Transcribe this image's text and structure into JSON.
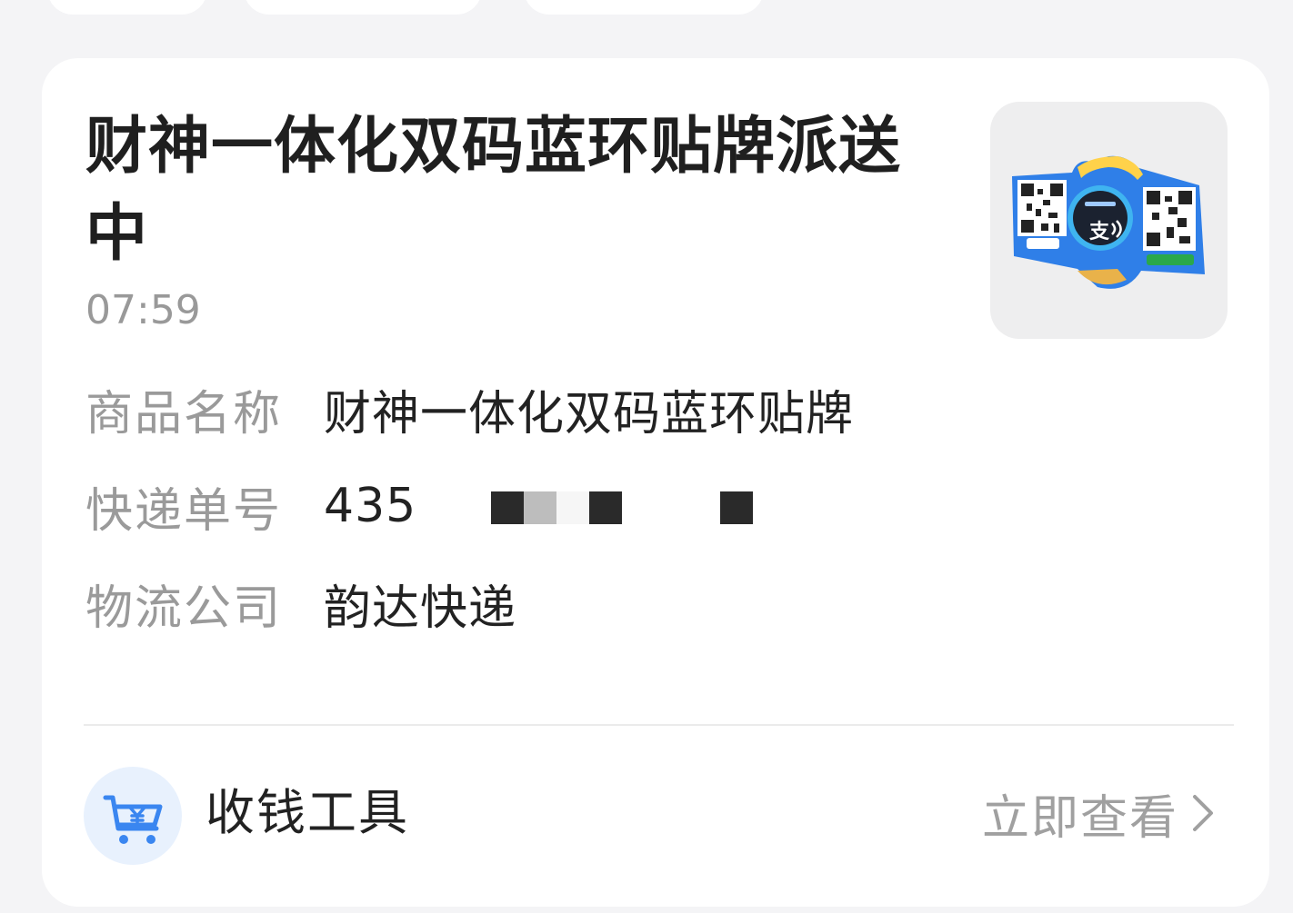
{
  "card": {
    "title": "财神一体化双码蓝环贴牌派送中",
    "time": "07:59",
    "rows": [
      {
        "label": "商品名称",
        "value": "财神一体化双码蓝环贴牌"
      },
      {
        "label": "快递单号",
        "value": "435"
      },
      {
        "label": "物流公司",
        "value": "韵达快递"
      }
    ],
    "product_image": {
      "icon": "alipay-qr-stand-image"
    }
  },
  "footer": {
    "tool_icon": "cart-yuan-icon",
    "tool_label": "收钱工具",
    "action_label": "立即查看",
    "action_icon": "chevron-right-icon"
  },
  "colors": {
    "background": "#f4f4f6",
    "card": "#ffffff",
    "icon_bg": "#e8f1fd",
    "icon_blue": "#3a86f0",
    "muted_text": "#9a9a9a",
    "primary_text": "#1f1f1f"
  }
}
